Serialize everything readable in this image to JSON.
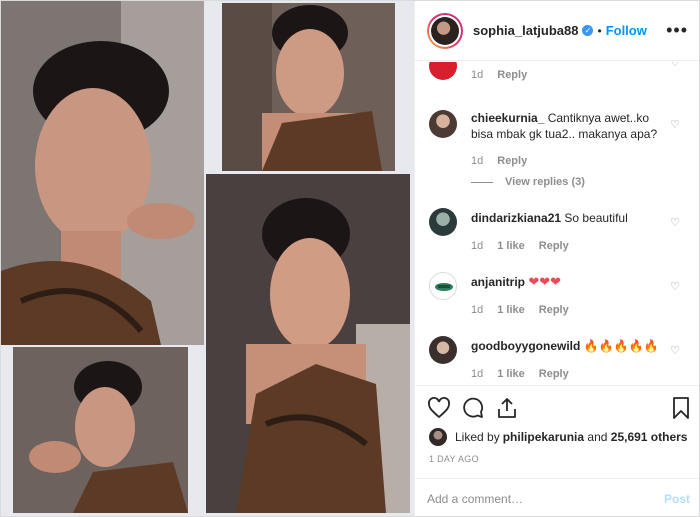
{
  "post": {
    "username": "sophia_latjuba88",
    "verified_icon": "verified-badge-icon",
    "separator": "•",
    "follow_label": "Follow",
    "more_label": "•••"
  },
  "comments": [
    {
      "username": "",
      "text": "",
      "time": "1d",
      "likes": "",
      "reply_label": "Reply"
    },
    {
      "username": "chieekurnia_",
      "text": "Cantiknya awet..ko bisa mbak gk tua2.. makanya apa?",
      "time": "1d",
      "likes": "",
      "reply_label": "Reply",
      "view_replies": "View replies (3)"
    },
    {
      "username": "dindarizkiana21",
      "text": "So beautiful",
      "time": "1d",
      "likes": "1 like",
      "reply_label": "Reply"
    },
    {
      "username": "anjanitrip",
      "text": "❤❤❤",
      "time": "1d",
      "likes": "1 like",
      "reply_label": "Reply"
    },
    {
      "username": "goodboyygonewild",
      "text": "🔥🔥🔥🔥🔥",
      "time": "1d",
      "likes": "1 like",
      "reply_label": "Reply"
    }
  ],
  "likes": {
    "prefix": "Liked by ",
    "user": "philipekarunia",
    "middle": " and ",
    "count": "25,691 others"
  },
  "timestamp": "1 DAY AGO",
  "add_comment": {
    "placeholder": "Add a comment…",
    "post_label": "Post"
  },
  "colors": {
    "accent": "#0095f6",
    "heart_red": "#ed4956",
    "muted": "#8e8e8e"
  }
}
